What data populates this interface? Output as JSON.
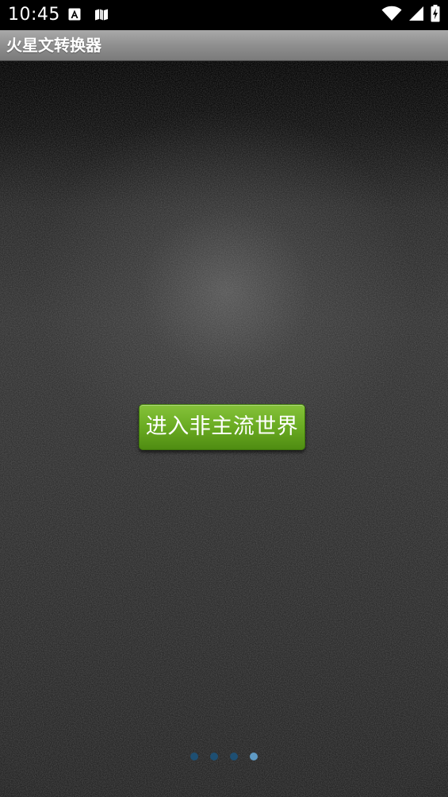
{
  "status_bar": {
    "time": "10:45",
    "icons": [
      "a-icon",
      "book-icon",
      "wifi-icon",
      "signal-icon",
      "battery-charging-icon"
    ]
  },
  "app": {
    "title": "火星文转换器"
  },
  "main": {
    "enter_button_label": "进入非主流世界"
  },
  "pager": {
    "page_count": 4,
    "current_page": 4
  },
  "colors": {
    "button_green": "#6aab22",
    "dot_inactive": "#1e4f72",
    "dot_active": "#5f9ac4",
    "title_bar_gray": "#8f8f8f"
  }
}
